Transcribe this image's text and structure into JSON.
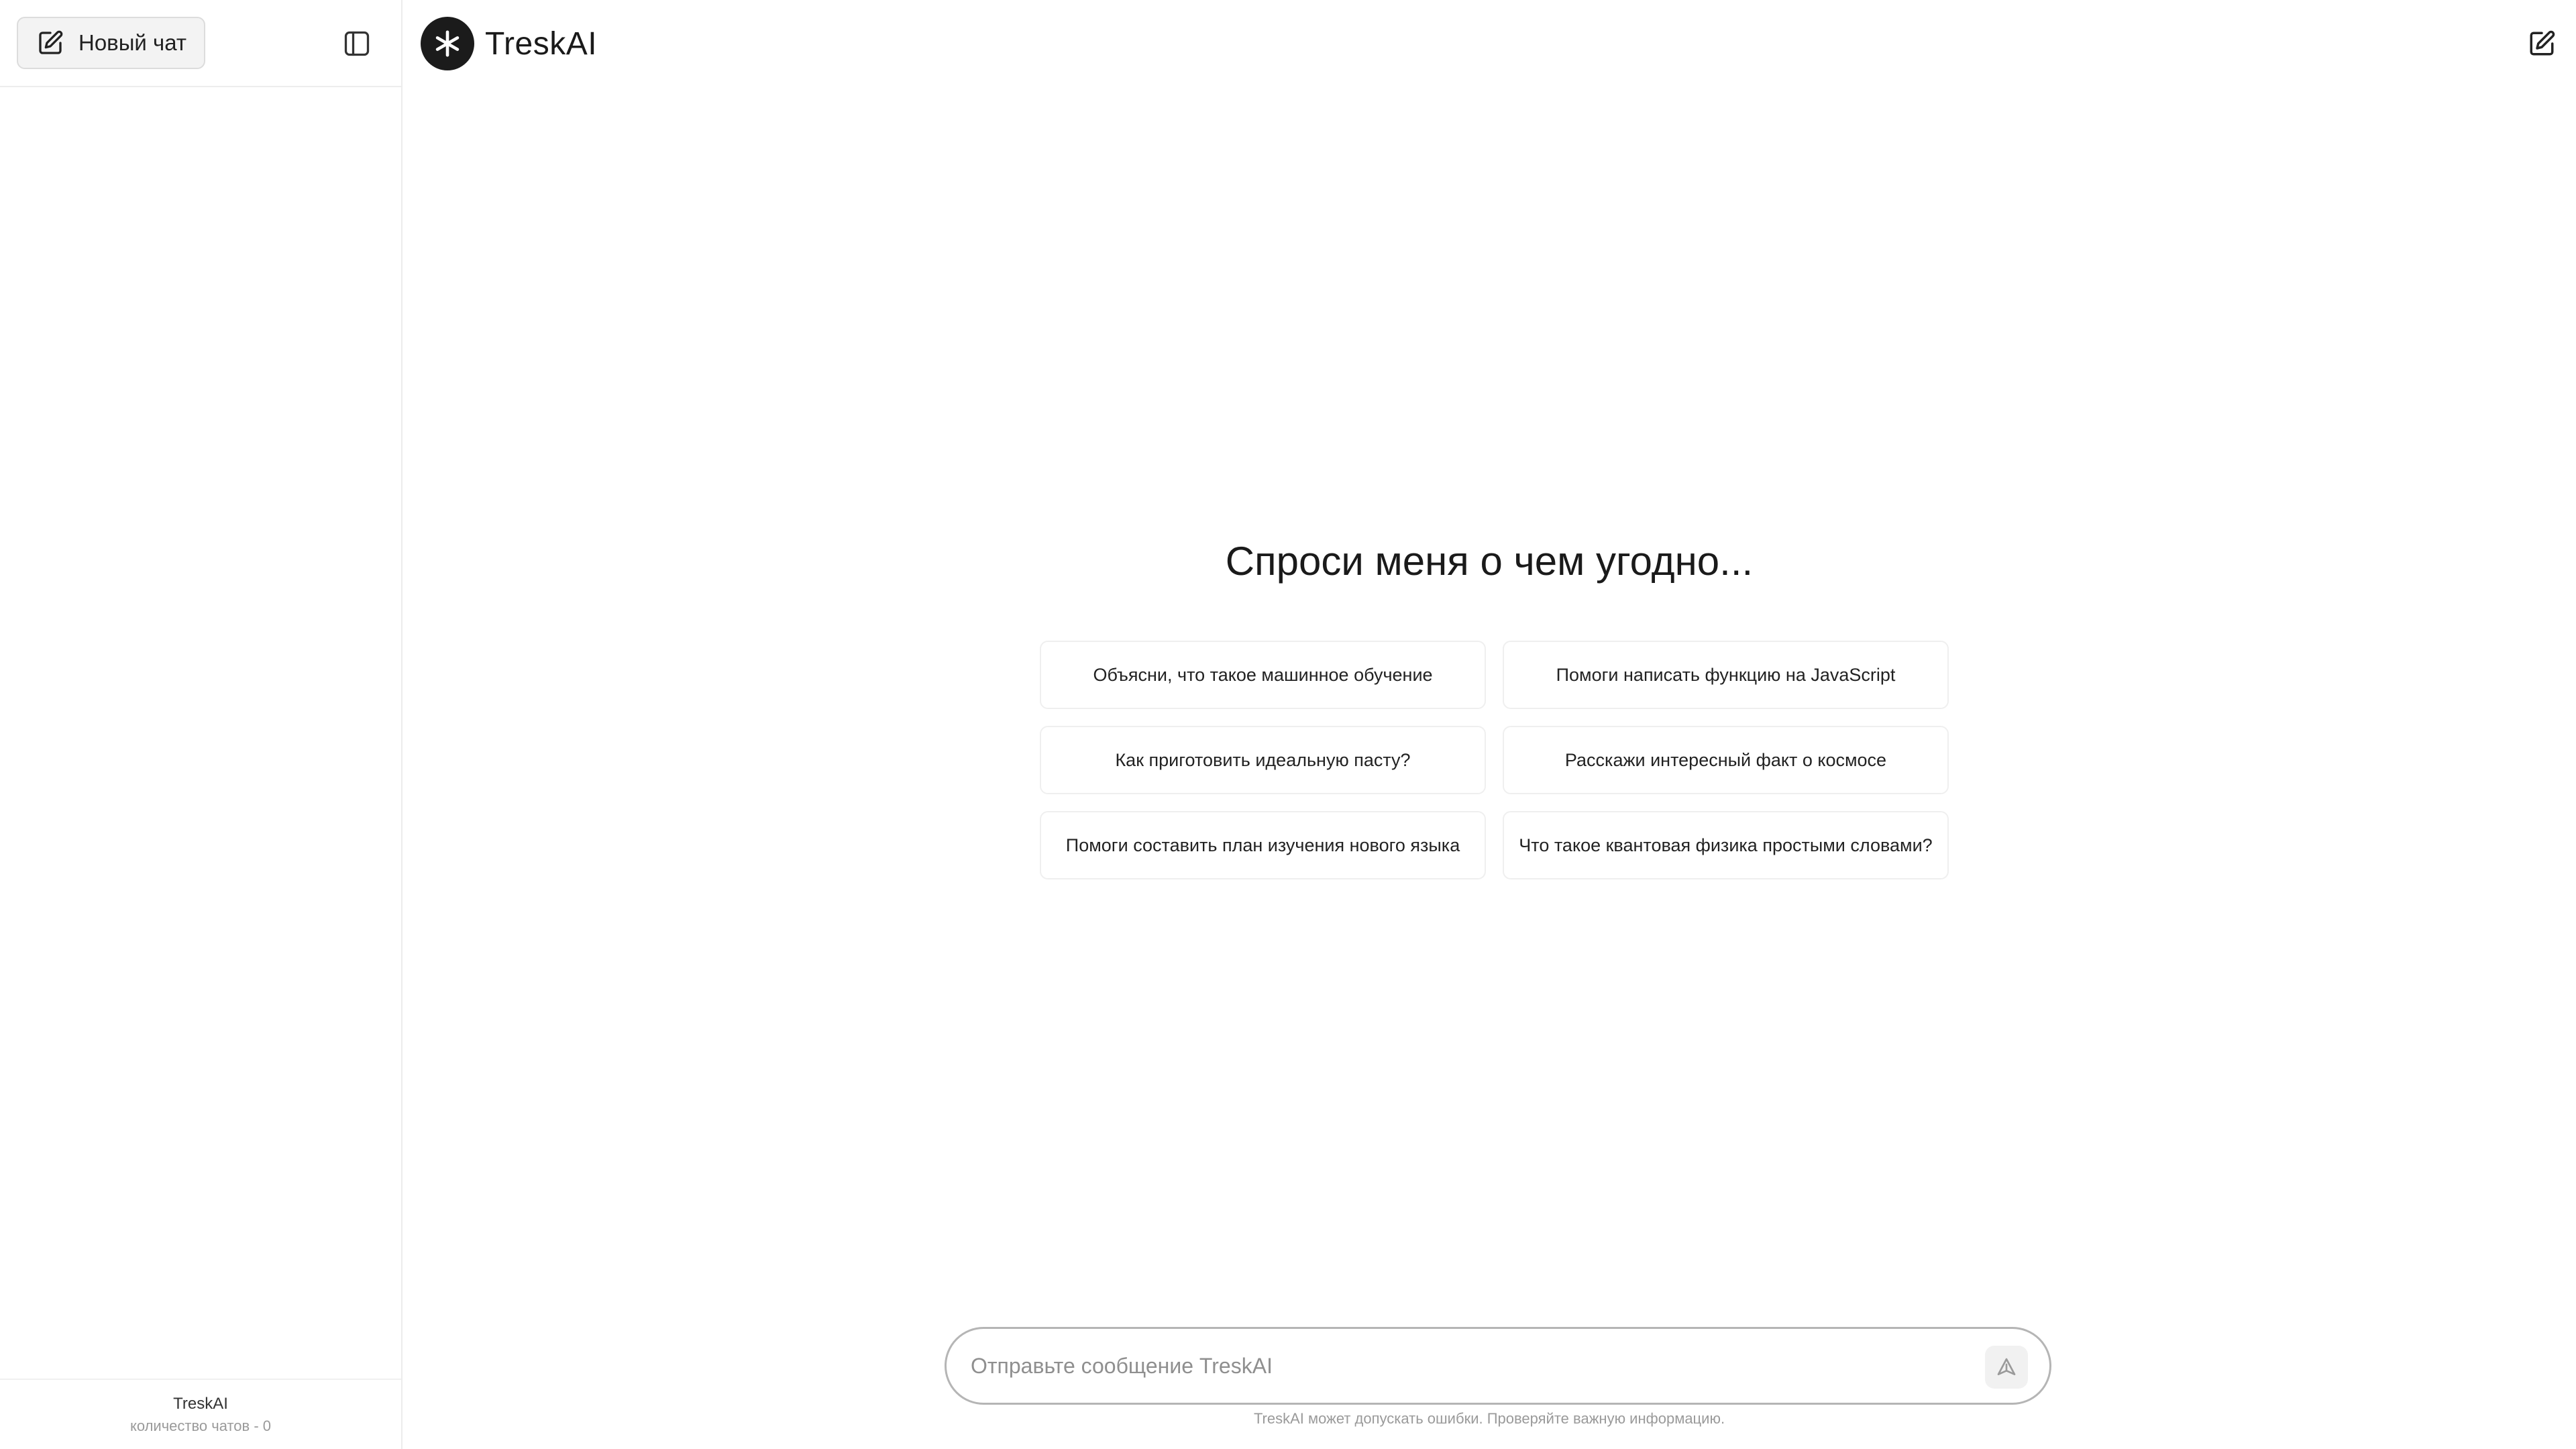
{
  "sidebar": {
    "new_chat_label": "Новый чат",
    "new_chat_icon": "pencil-square-icon",
    "toggle_icon": "sidebar-panel-icon",
    "footer": {
      "app_name": "TreskAI",
      "chat_count": "количество чатов - 0"
    }
  },
  "header": {
    "brand_name": "TreskAI",
    "logo_icon": "asterisk-logo-icon",
    "new_chat_icon": "pencil-square-icon"
  },
  "main": {
    "title": "Спроси меня о чем угодно...",
    "suggestions": [
      "Объясни, что такое машинное обучение",
      "Помоги написать функцию на JavaScript",
      "Как приготовить идеальную пасту?",
      "Расскажи интересный факт о космосе",
      "Помоги составить план изучения нового языка",
      "Что такое квантовая физика простыми словами?"
    ]
  },
  "composer": {
    "placeholder": "Отправьте сообщение TreskAI",
    "value": "",
    "send_icon": "send-arrow-icon"
  },
  "disclaimer": "TreskAI может допускать ошибки. Проверяйте важную информацию.",
  "colors": {
    "logo_bg": "#1b1b1b",
    "button_bg": "#f3f3f3",
    "border": "#ececec",
    "muted_text": "#9a9a9a"
  }
}
